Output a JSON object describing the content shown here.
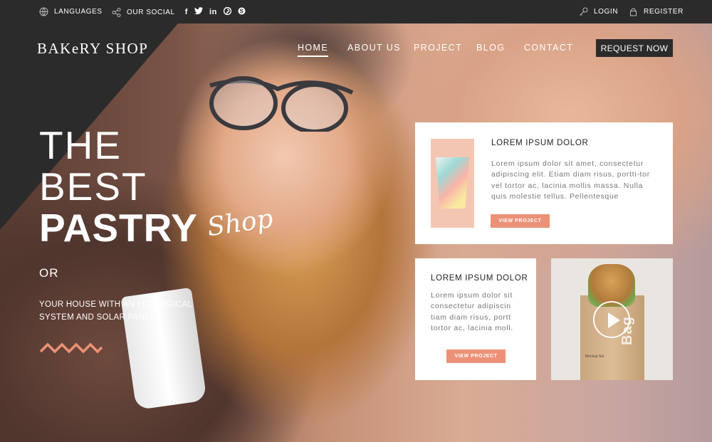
{
  "topbar": {
    "languages": "LANGUAGES",
    "our_social": "OUR SOCIAL",
    "login": "LOGIN",
    "register": "REGISTER",
    "social_icons": [
      "facebook-icon",
      "twitter-icon",
      "linkedin-icon",
      "pinterest-icon",
      "skype-icon"
    ]
  },
  "header": {
    "logo": "BAKeRY SHOP",
    "nav": [
      "HOME",
      "ABOUT US",
      "PROJECT",
      "BLOG",
      "CONTACT"
    ],
    "active_nav": "HOME",
    "request_button": "REQUEST NOW"
  },
  "hero": {
    "line1": "THE",
    "line2": "BEST",
    "line3": "PASTRY",
    "script": "Shop",
    "or": "OR",
    "description": "YOUR HOUSE WITH AN ECOLOGICAL SYSTEM AND SOLAR PANEL",
    "zigzag_color": "#ec9177"
  },
  "cards": {
    "card1": {
      "title": "LOREM IPSUM DOLOR",
      "text": "Lorem ipsum dolor sit amet, consectetur adipiscing elit. Etiam diam risus, portti-tor vel tortor ac, lacinia mollis massa. Nulla quis molestie tellus. Pellentesque",
      "button": "VIEW PROJECT"
    },
    "card2": {
      "title": "LOREM IPSUM DOLOR",
      "text": "Lorem ipsum dolor sit consectetur adipiscin tiam diam risus, portt tortor ac, lacinia moll.",
      "button": "VIEW PROJECT"
    },
    "card3": {
      "bag_label": "Bag",
      "bag_small": "Mockup Set"
    }
  },
  "colors": {
    "accent": "#ec9177",
    "dark": "#2c2b2c"
  }
}
